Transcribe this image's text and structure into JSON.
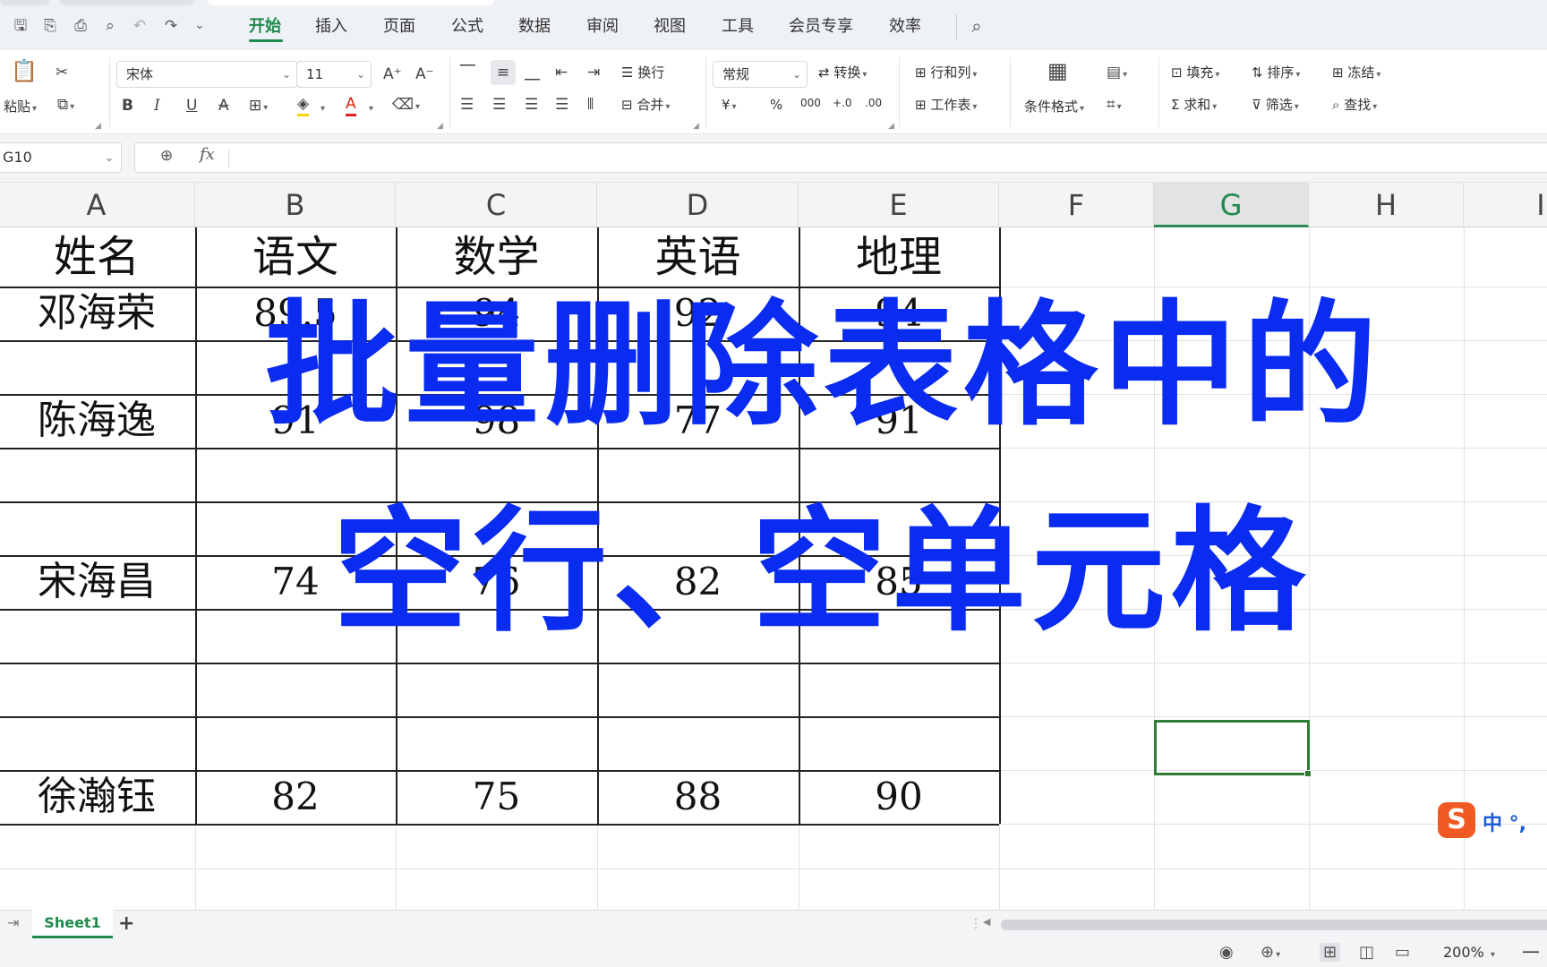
{
  "menu": {
    "items": [
      "开始",
      "插入",
      "页面",
      "公式",
      "数据",
      "审阅",
      "视图",
      "工具",
      "会员专享",
      "效率"
    ],
    "active": "开始"
  },
  "ribbon": {
    "paste": "粘贴",
    "font_name": "宋体",
    "font_size": "11",
    "bold": "B",
    "italic": "I",
    "underline": "U",
    "wrap": "换行",
    "merge": "合并",
    "number_format": "常规",
    "convert": "转换",
    "rows_cols": "行和列",
    "worksheet": "工作表",
    "conditional_format": "条件格式",
    "fill": "填充",
    "sort": "排序",
    "freeze": "冻结",
    "sum": "求和",
    "filter": "筛选",
    "find": "查找",
    "currency": "¥",
    "percent": "%",
    "thousands": "000",
    "dec_inc": "+.0",
    "dec_dec": ".00"
  },
  "formula_bar": {
    "name_box": "G10",
    "fx": "fx",
    "content": ""
  },
  "columns": [
    "A",
    "B",
    "C",
    "D",
    "E",
    "F",
    "G",
    "H",
    "I"
  ],
  "selected_column": "G",
  "table": {
    "headers": [
      "姓名",
      "语文",
      "数学",
      "英语",
      "地理"
    ],
    "rows": [
      [
        "邓海荣",
        "89.5",
        "94",
        "92",
        "94"
      ],
      [
        "",
        "",
        "",
        "",
        ""
      ],
      [
        "陈海逸",
        "91",
        "98",
        "77",
        "91"
      ],
      [
        "",
        "",
        "",
        "",
        ""
      ],
      [
        "",
        "",
        "",
        "",
        ""
      ],
      [
        "宋海昌",
        "74",
        "76",
        "82",
        "85"
      ],
      [
        "",
        "",
        "",
        "",
        ""
      ],
      [
        "",
        "",
        "",
        "",
        ""
      ],
      [
        "",
        "",
        "",
        "",
        ""
      ],
      [
        "徐瀚钰",
        "82",
        "75",
        "88",
        "90"
      ]
    ]
  },
  "overlay": {
    "line1": "批量删除表格中的",
    "line2": "空行、空单元格"
  },
  "ime": {
    "logo": "S",
    "text": "中 °,"
  },
  "sheets": {
    "tabs": [
      "Sheet1"
    ],
    "add": "+"
  },
  "status": {
    "zoom": "200%"
  }
}
